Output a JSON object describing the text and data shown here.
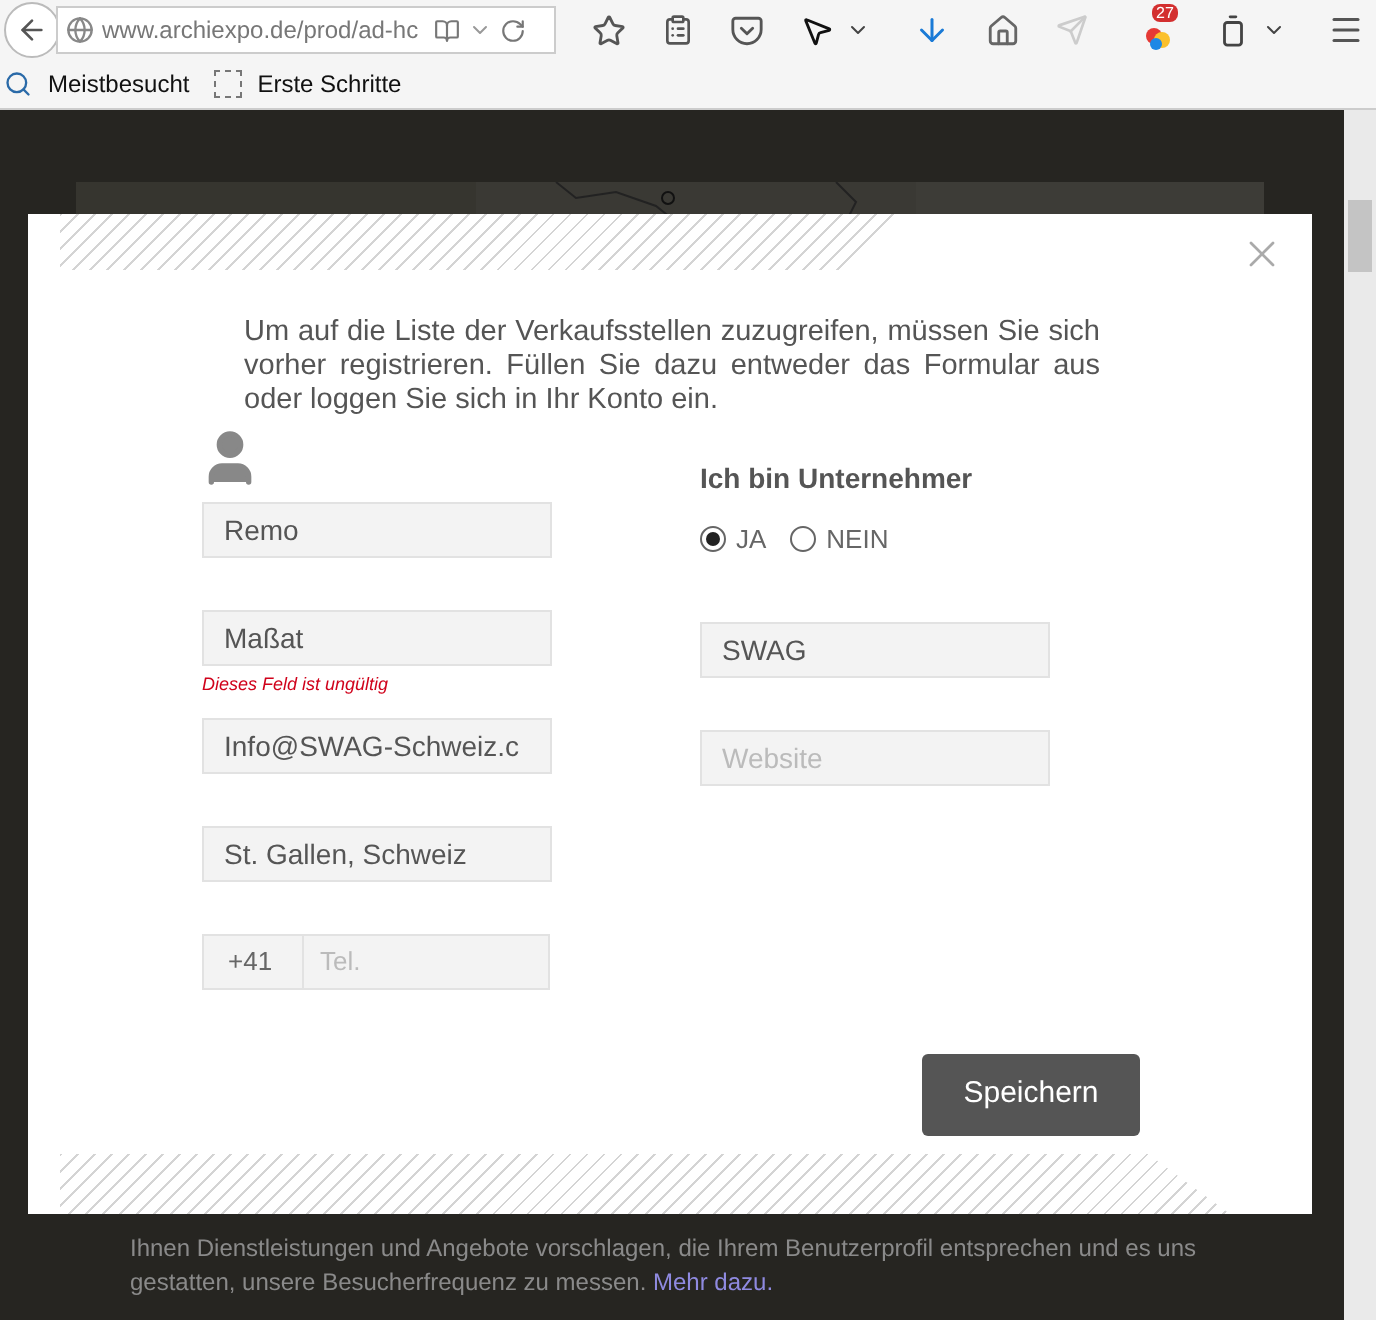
{
  "browser": {
    "url": "www.archiexpo.de/prod/ad-hc",
    "badge": "27",
    "bookmarks": [
      "Meistbesucht",
      "Erste Schritte"
    ]
  },
  "background": {
    "cookie_text": "Ihnen Dienstleistungen und Angebote vorschlagen, die Ihrem Benutzerprofil entsprechen und es uns gestatten, unsere Besucherfrequenz zu messen.",
    "link": "Mehr dazu."
  },
  "modal": {
    "intro": "Um auf die Liste der Verkaufsstellen zuzugreifen, müssen Sie sich vorher registrieren. Füllen Sie dazu entweder das Formular aus oder loggen Sie sich in Ihr Konto ein.",
    "left_fields": [
      {
        "kind": "text",
        "value": "Remo"
      },
      {
        "kind": "text",
        "value": "Maßat",
        "error": "Dieses Feld ist ungültig"
      },
      {
        "kind": "text",
        "value": "Info@SWAG-Schweiz.c"
      },
      {
        "kind": "text",
        "value": "St. Gallen, Schweiz"
      },
      {
        "kind": "phone",
        "prefix": "+41",
        "placeholder": "Tel."
      }
    ],
    "heading": "Ich bin Unternehmer",
    "radios": [
      {
        "label": "JA",
        "selected": true
      },
      {
        "label": "NEIN",
        "selected": false
      }
    ],
    "right_fields": [
      {
        "kind": "text",
        "value": "SWAG"
      },
      {
        "kind": "text",
        "placeholder": "Website"
      }
    ],
    "button": "Speichern"
  }
}
